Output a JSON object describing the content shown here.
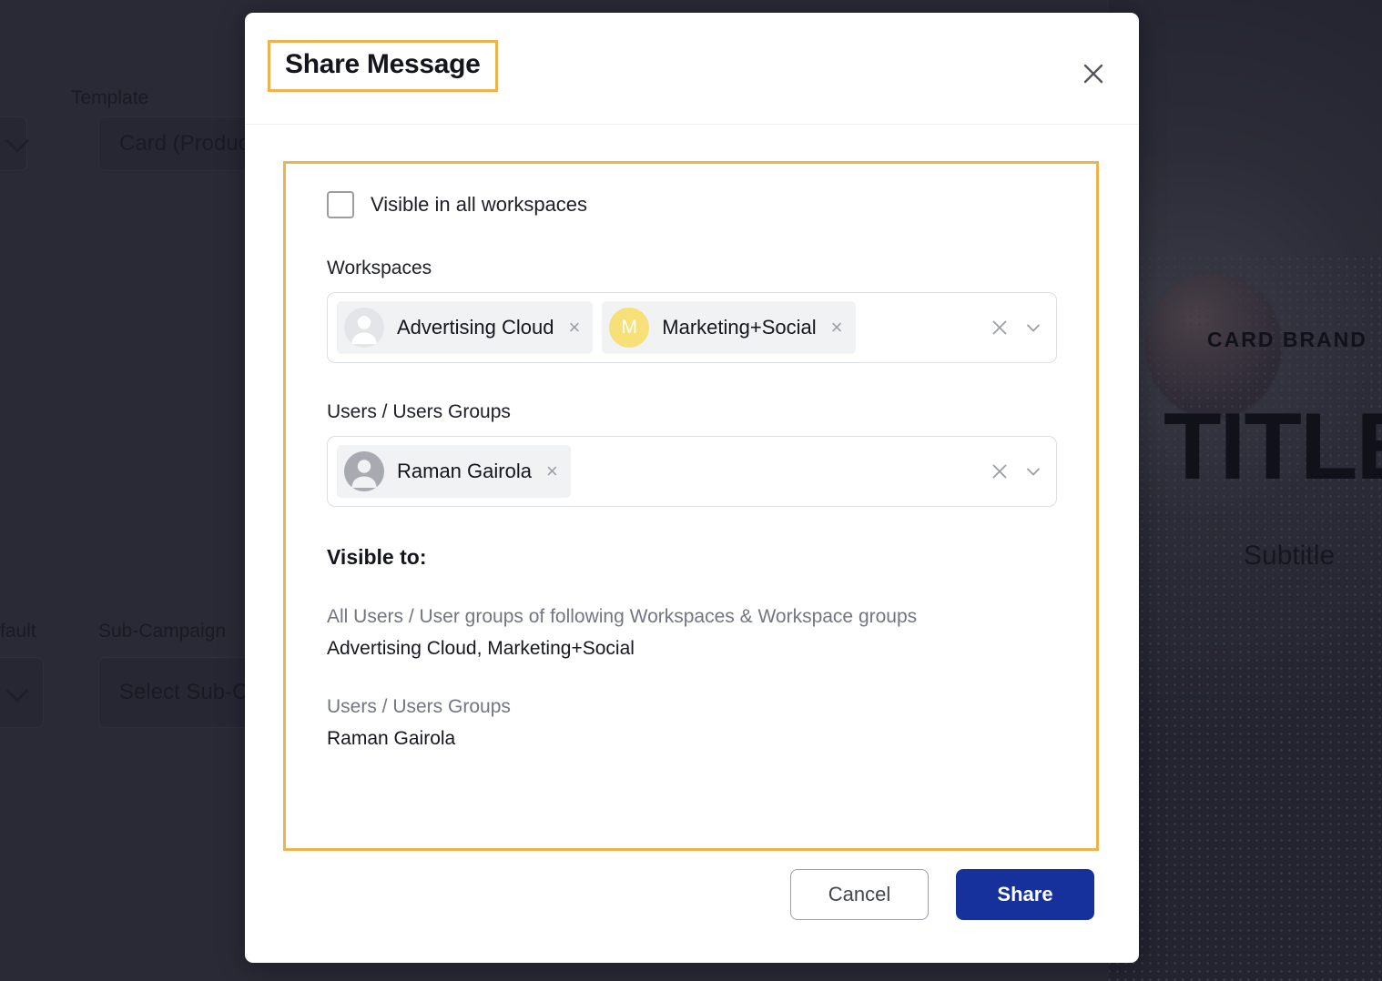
{
  "background": {
    "fields": [
      {
        "label": "Template",
        "value": "Card (Product"
      },
      {
        "label": "fault",
        "value": ""
      },
      {
        "label": "Sub-Campaign",
        "value": "Select Sub-C"
      }
    ],
    "card_preview": {
      "brand": "CARD BRAND",
      "title": "TITLE",
      "subtitle": "Subtitle"
    }
  },
  "modal": {
    "title": "Share Message",
    "close_icon": "close-icon",
    "visible_all": {
      "label": "Visible in all workspaces",
      "checked": false
    },
    "workspaces": {
      "label": "Workspaces",
      "chips": [
        {
          "name": "Advertising Cloud",
          "avatar": "person-icon",
          "avatar_style": "light",
          "remove": "×"
        },
        {
          "name": "Marketing+Social",
          "avatar": "M",
          "avatar_style": "yellow",
          "remove": "×"
        }
      ],
      "clear_icon": "clear-icon",
      "dropdown_icon": "chevron-down-icon"
    },
    "users": {
      "label": "Users / Users Groups",
      "chips": [
        {
          "name": "Raman Gairola",
          "avatar": "person-icon",
          "avatar_style": "dark",
          "remove": "×"
        }
      ],
      "clear_icon": "clear-icon",
      "dropdown_icon": "chevron-down-icon"
    },
    "visible_to": {
      "title": "Visible to:",
      "workspaces_caption": "All Users / User groups of following Workspaces & Workspace groups",
      "workspaces_value": "Advertising Cloud, Marketing+Social",
      "users_caption": "Users / Users Groups",
      "users_value": "Raman Gairola"
    },
    "footer": {
      "cancel_label": "Cancel",
      "share_label": "Share"
    }
  },
  "colors": {
    "highlight": "#eeb34e",
    "primary": "#16309c",
    "backdrop": "#292a35",
    "avatar_yellow": "#f7e077"
  }
}
